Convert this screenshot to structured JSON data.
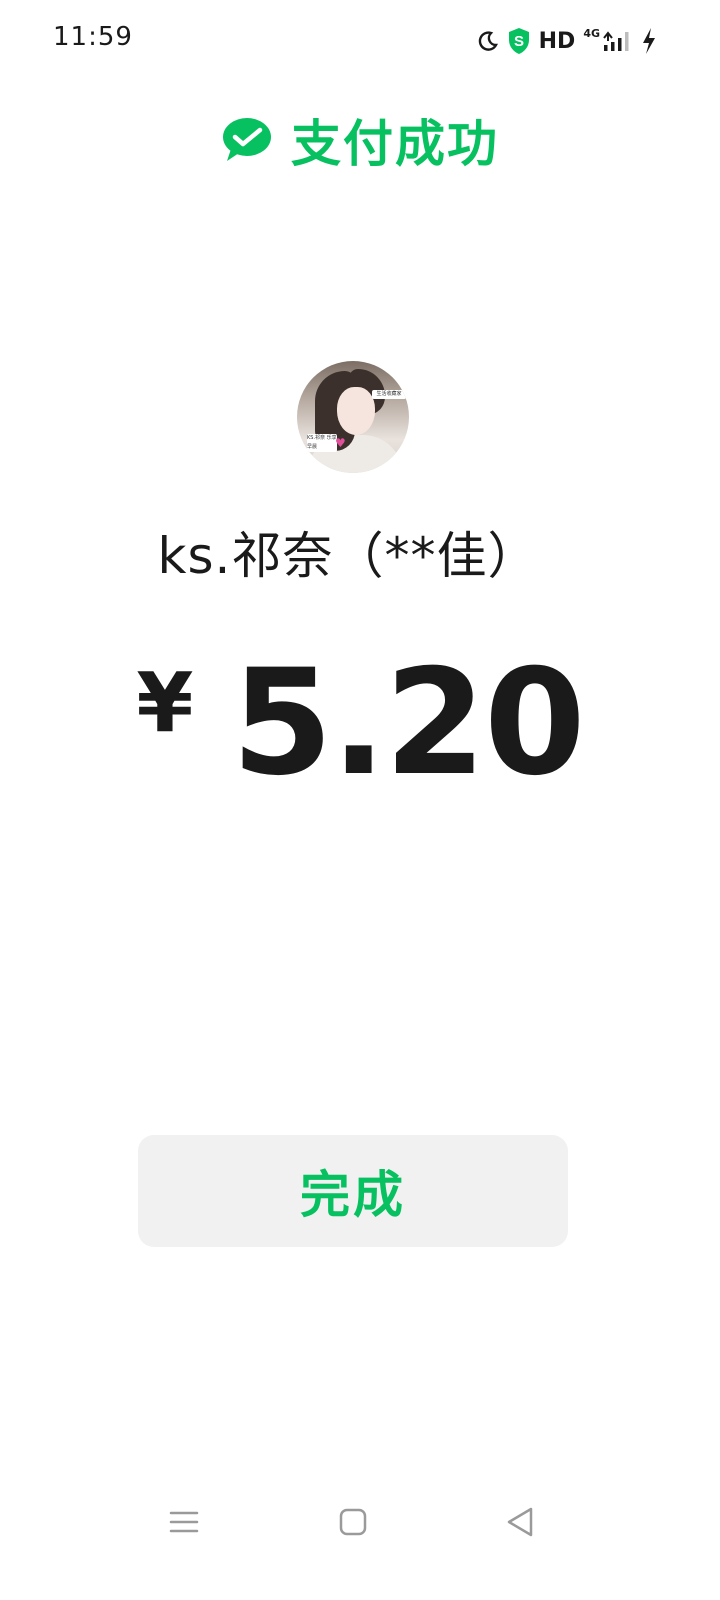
{
  "status_bar": {
    "time": "11:59",
    "hd": "HD",
    "network": "4G",
    "icons": [
      "moon-icon",
      "shield-icon",
      "signal-icon",
      "charging-icon"
    ]
  },
  "header": {
    "title": "支付成功",
    "icon": "wechat-pay-icon"
  },
  "payee": {
    "name": "ks.祁奈（**佳）",
    "avatar_sticker_top": "生活收藏家",
    "avatar_sticker_bottom": "KS.祁奈 乐享早晨"
  },
  "amount": {
    "currency": "¥",
    "value": "5.20"
  },
  "done_button": {
    "label": "完成"
  },
  "nav_bar": {
    "icons": [
      "menu-icon",
      "home-icon",
      "back-icon"
    ]
  },
  "colors": {
    "accent": "#07c160",
    "text": "#1a1a1a",
    "button_bg": "#f1f1f1"
  }
}
